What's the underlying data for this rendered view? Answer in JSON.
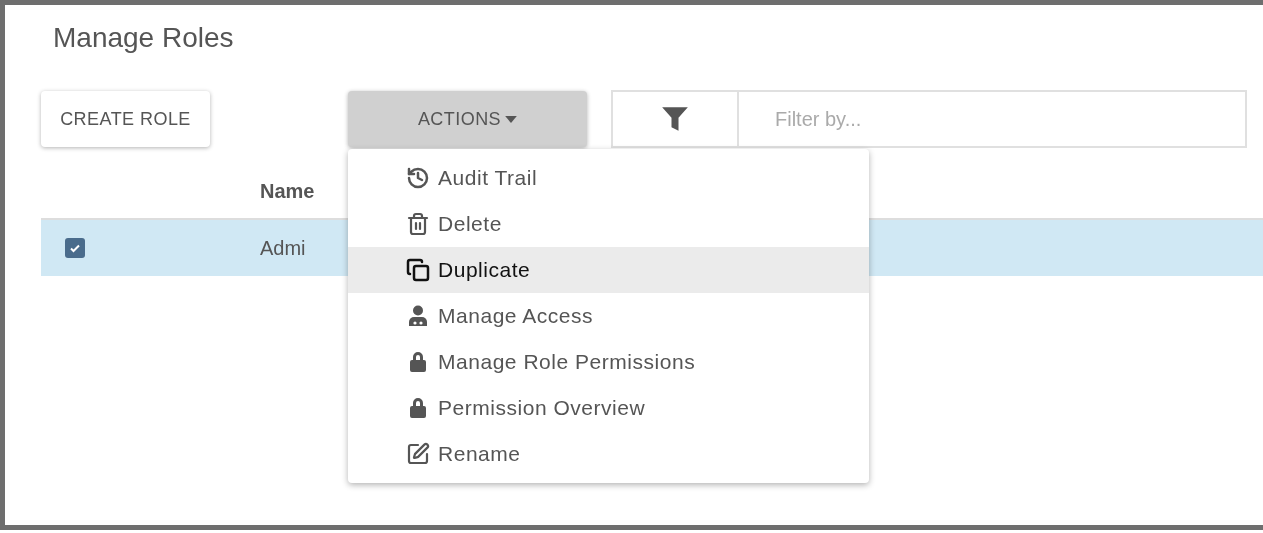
{
  "title": "Manage Roles",
  "toolbar": {
    "create_button": "CREATE ROLE",
    "actions_button": {
      "label": "ACTIONS",
      "expanded": true
    },
    "filter": {
      "placeholder": "Filter by..."
    }
  },
  "table": {
    "columns": [
      "Name"
    ],
    "rows": [
      {
        "checked": true,
        "selected": true,
        "cells": [
          "Admi"
        ]
      }
    ]
  },
  "menu": [
    {
      "label": "Audit Trail",
      "kind": "history",
      "selected": false
    },
    {
      "label": "Delete",
      "kind": "trash",
      "selected": false
    },
    {
      "label": "Duplicate",
      "kind": "copy",
      "selected": true
    },
    {
      "label": "Manage Access",
      "kind": "person",
      "selected": false
    },
    {
      "label": "Manage Role Permissions",
      "kind": "lock",
      "selected": false
    },
    {
      "label": "Permission Overview",
      "kind": "lock",
      "selected": false
    },
    {
      "label": "Rename",
      "kind": "edit",
      "selected": false
    }
  ]
}
